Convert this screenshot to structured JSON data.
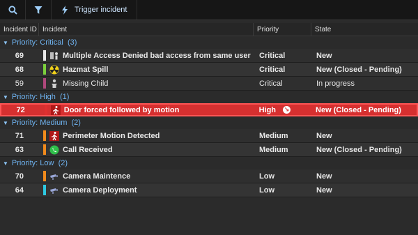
{
  "toolbar": {
    "search_icon": "search-icon",
    "filter_icon": "filter-icon",
    "trigger_label": "Trigger incident"
  },
  "columns": {
    "id": "Incident ID",
    "incident": "Incident",
    "priority": "Priority",
    "state": "State"
  },
  "groups": {
    "critical": {
      "name": "Priority: Critical",
      "count": "(3)"
    },
    "high": {
      "name": "Priority: High",
      "count": "(1)"
    },
    "medium": {
      "name": "Priority: Medium",
      "count": "(2)"
    },
    "low": {
      "name": "Priority: Low",
      "count": "(2)"
    }
  },
  "rows": [
    {
      "id": "69",
      "title": "Multiple Access Denied bad access from same user",
      "priority": "Critical",
      "state": "New",
      "color": "#e8e8e8",
      "icon": "access-denied-icon"
    },
    {
      "id": "68",
      "title": "Hazmat Spill",
      "priority": "Critical",
      "state": "New (Closed - Pending)",
      "color": "#7ccf3c",
      "icon": "hazmat-icon"
    },
    {
      "id": "59",
      "title": "Missing Child",
      "priority": "Critical",
      "state": "In progress",
      "color": "#b0487c",
      "icon": "child-icon"
    },
    {
      "id": "72",
      "title": "Door forced followed by motion",
      "priority": "High",
      "state": "New (Closed - Pending)",
      "color": "#e03030",
      "icon": "running-person-icon"
    },
    {
      "id": "71",
      "title": "Perimeter Motion Detected",
      "priority": "Medium",
      "state": "New",
      "color": "#f08a1c",
      "icon": "running-person-icon"
    },
    {
      "id": "63",
      "title": "Call Received",
      "priority": "Medium",
      "state": "New (Closed - Pending)",
      "color": "#f08a1c",
      "icon": "phone-icon"
    },
    {
      "id": "70",
      "title": "Camera Maintence",
      "priority": "Low",
      "state": "New",
      "color": "#f08a1c",
      "icon": "camera-icon"
    },
    {
      "id": "64",
      "title": "Camera Deployment",
      "priority": "Low",
      "state": "New",
      "color": "#2ec8e0",
      "icon": "camera-icon"
    }
  ]
}
